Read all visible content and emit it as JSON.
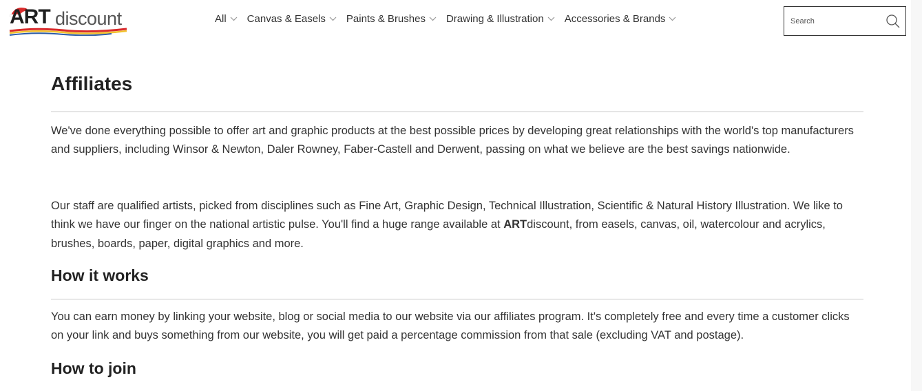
{
  "header": {
    "logo": {
      "brand_bold": "ART",
      "brand_rest": "discount"
    },
    "nav": [
      {
        "label": "All"
      },
      {
        "label": "Canvas & Easels"
      },
      {
        "label": "Paints & Brushes"
      },
      {
        "label": "Drawing & Illustration"
      },
      {
        "label": "Accessories & Brands"
      }
    ],
    "search": {
      "placeholder": "Search",
      "icon": "search-icon"
    }
  },
  "main": {
    "title": "Affiliates",
    "intro_1": "We've done everything possible to offer art and graphic products at the best possible prices by developing great relationships with the world's top manufacturers and suppliers, including Winsor & Newton, Daler Rowney, Faber-Castell and Derwent, passing on what we believe are the best savings nationwide.",
    "intro_2_before": "Our staff are qualified artists, picked from disciplines such as Fine Art, Graphic Design, Technical Illustration, Scientific & Natural History Illustration. We like to think we have our finger on the national artistic pulse. You'll find a huge range available at ",
    "intro_2_brand_bold": "ART",
    "intro_2_brand_rest": "discount",
    "intro_2_after": ", from easels, canvas, oil, watercolour and acrylics, brushes, boards, paper, digital graphics and more.",
    "section_how_it_works": "How it works",
    "how_it_works_text": "You can earn money by linking your website, blog or social media to our website via our affiliates program. It's completely free and every time a customer clicks on your link and buys something from our website, you will get paid a percentage commission from that sale (excluding VAT and postage).",
    "section_how_to_join": "How to join"
  },
  "colors": {
    "text": "#333333",
    "heading": "#222222",
    "rule": "#c8c8c8",
    "logo_red": "#d92b2b",
    "logo_yellow": "#f2c12e",
    "logo_blue": "#2a5aa8"
  }
}
